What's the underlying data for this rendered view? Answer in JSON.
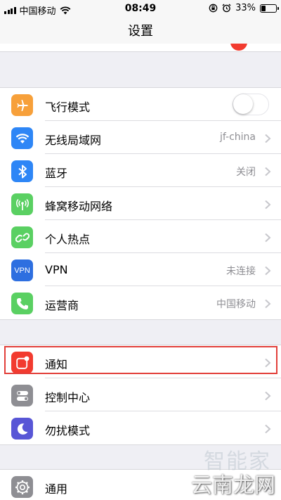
{
  "status_bar": {
    "carrier": "中国移动",
    "time": "08:49",
    "battery_percent": "33%",
    "battery_level": 0.33
  },
  "nav": {
    "title": "设置"
  },
  "groups": [
    [
      {
        "id": "airplane",
        "label": "飞行模式",
        "icon": "airplane-icon",
        "color": "#f7a03a",
        "toggle": false
      },
      {
        "id": "wifi",
        "label": "无线局域网",
        "value": "jf-china",
        "icon": "wifi-icon",
        "color": "#2e86f6"
      },
      {
        "id": "bluetooth",
        "label": "蓝牙",
        "value": "关闭",
        "icon": "bluetooth-icon",
        "color": "#2e86f6"
      },
      {
        "id": "cellular",
        "label": "蜂窝移动网络",
        "icon": "cellular-icon",
        "color": "#5ad062"
      },
      {
        "id": "hotspot",
        "label": "个人热点",
        "icon": "hotspot-icon",
        "color": "#5ad062"
      },
      {
        "id": "vpn",
        "label": "VPN",
        "value": "未连接",
        "icon": "vpn-icon",
        "color": "#2e6fe0",
        "icon_text": "VPN"
      },
      {
        "id": "carrier",
        "label": "运营商",
        "value": "中国移动",
        "icon": "phone-icon",
        "color": "#5ad062"
      }
    ],
    [
      {
        "id": "notifications",
        "label": "通知",
        "icon": "notifications-icon",
        "color": "#f23b2f"
      },
      {
        "id": "control-center",
        "label": "控制中心",
        "icon": "control-center-icon",
        "color": "#8e8e93"
      },
      {
        "id": "dnd",
        "label": "勿扰模式",
        "icon": "moon-icon",
        "color": "#5856d6"
      }
    ],
    [
      {
        "id": "general",
        "label": "通用",
        "icon": "gear-icon",
        "color": "#8e8e93"
      }
    ]
  ],
  "watermark": {
    "text": "云南龙网",
    "faint": "智能家"
  }
}
